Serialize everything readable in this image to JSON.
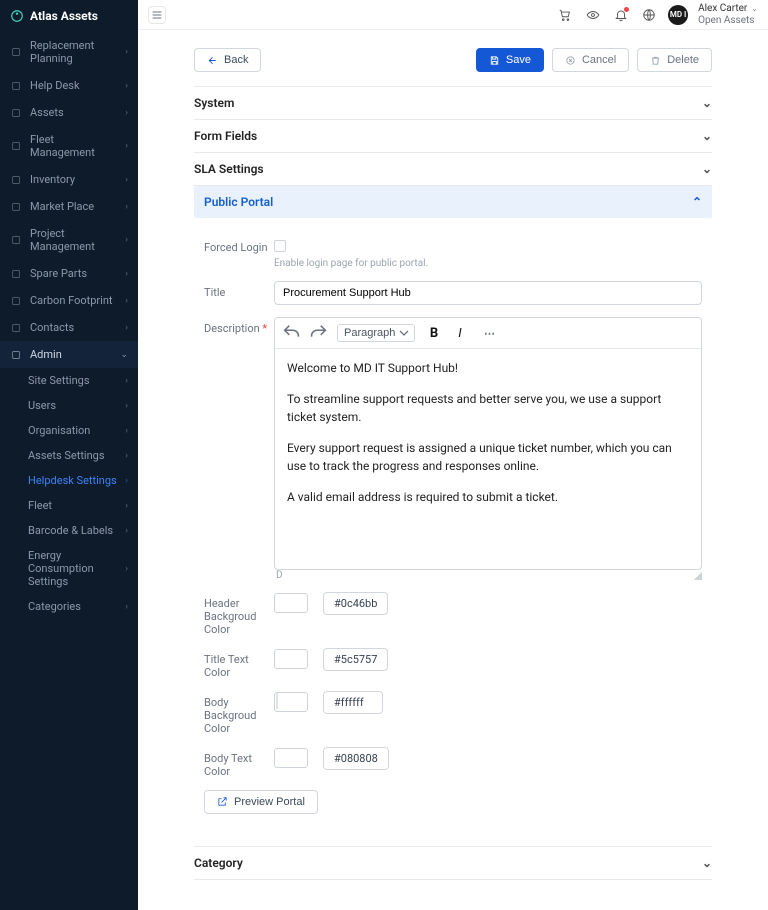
{
  "app": {
    "name": "Atlas Assets"
  },
  "sidebar": {
    "items": [
      {
        "label": "Replacement Planning",
        "ico": "repeat"
      },
      {
        "label": "Help Desk",
        "ico": "question"
      },
      {
        "label": "Assets",
        "ico": "grid"
      },
      {
        "label": "Fleet Management",
        "ico": "truck"
      },
      {
        "label": "Inventory",
        "ico": "box"
      },
      {
        "label": "Market Place",
        "ico": "bag"
      },
      {
        "label": "Project Management",
        "ico": "board"
      },
      {
        "label": "Spare Parts",
        "ico": "wrench"
      },
      {
        "label": "Carbon Footprint",
        "ico": "leaf"
      },
      {
        "label": "Contacts",
        "ico": "user"
      },
      {
        "label": "Admin",
        "ico": "gear",
        "expanded": true
      }
    ],
    "admin_children": [
      {
        "label": "Site Settings"
      },
      {
        "label": "Users"
      },
      {
        "label": "Organisation"
      },
      {
        "label": "Assets Settings"
      },
      {
        "label": "Helpdesk Settings",
        "active": true
      },
      {
        "label": "Fleet"
      },
      {
        "label": "Barcode & Labels"
      },
      {
        "label": "Energy Consumption Settings"
      },
      {
        "label": "Categories"
      }
    ]
  },
  "topbar": {
    "user_name": "Alex Carter",
    "user_org": "Open Assets",
    "avatar_text": "MD I"
  },
  "toolbar": {
    "back": "Back",
    "save": "Save",
    "cancel": "Cancel",
    "delete": "Delete"
  },
  "accordion": {
    "system": "System",
    "form_fields": "Form Fields",
    "sla": "SLA Settings",
    "public_portal": "Public Portal",
    "category": "Category"
  },
  "portal": {
    "forced_login_label": "Forced Login",
    "forced_login_help": "Enable login page for public portal.",
    "title_label": "Title",
    "title_value": "Procurement Support Hub",
    "description_label": "Description",
    "paragraph_style": "Paragraph",
    "body_p1": "Welcome to MD IT Support Hub!",
    "body_p2": "To streamline support requests and better serve you, we use a support ticket system.",
    "body_p3": "Every support request is assigned a unique ticket number, which you can use to track the progress and responses online.",
    "body_p4": "A valid email address is required to submit a ticket.",
    "foot_char": "D",
    "header_bg_label": "Header Backgroud Color",
    "header_bg_color": "#0c46bb",
    "title_text_label": "Title Text Color",
    "title_text_color": "#5c5757",
    "body_bg_label": "Body Backgroud Color",
    "body_bg_color": "#ffffff",
    "body_text_label": "Body Text Color",
    "body_text_color": "#080808",
    "preview_label": "Preview Portal"
  }
}
